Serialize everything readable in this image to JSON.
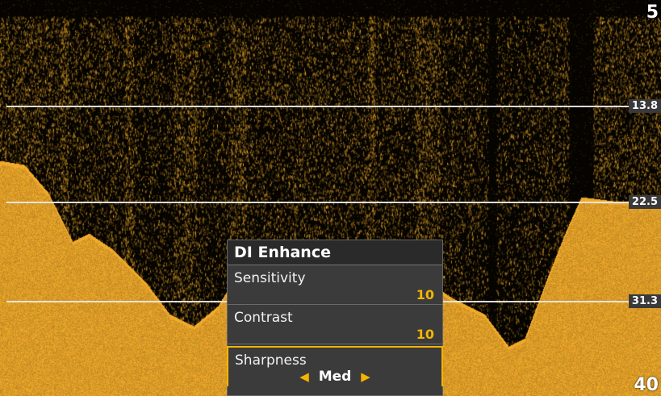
{
  "depth": {
    "top_value": "5",
    "bottom_value": "40",
    "grid_labels": [
      "13.8",
      "22.5",
      "31.3"
    ]
  },
  "menu": {
    "title": "DI Enhance",
    "items": [
      {
        "label": "Sensitivity",
        "value": "10"
      },
      {
        "label": "Contrast",
        "value": "10"
      }
    ],
    "selected": {
      "label": "Sharpness",
      "value": "Med",
      "left_arrow": "◀",
      "right_arrow": "▶"
    }
  },
  "colors": {
    "sonar_return": "#e2a52a",
    "accent": "#f5b400",
    "menu_bg": "#3b3b3b"
  }
}
